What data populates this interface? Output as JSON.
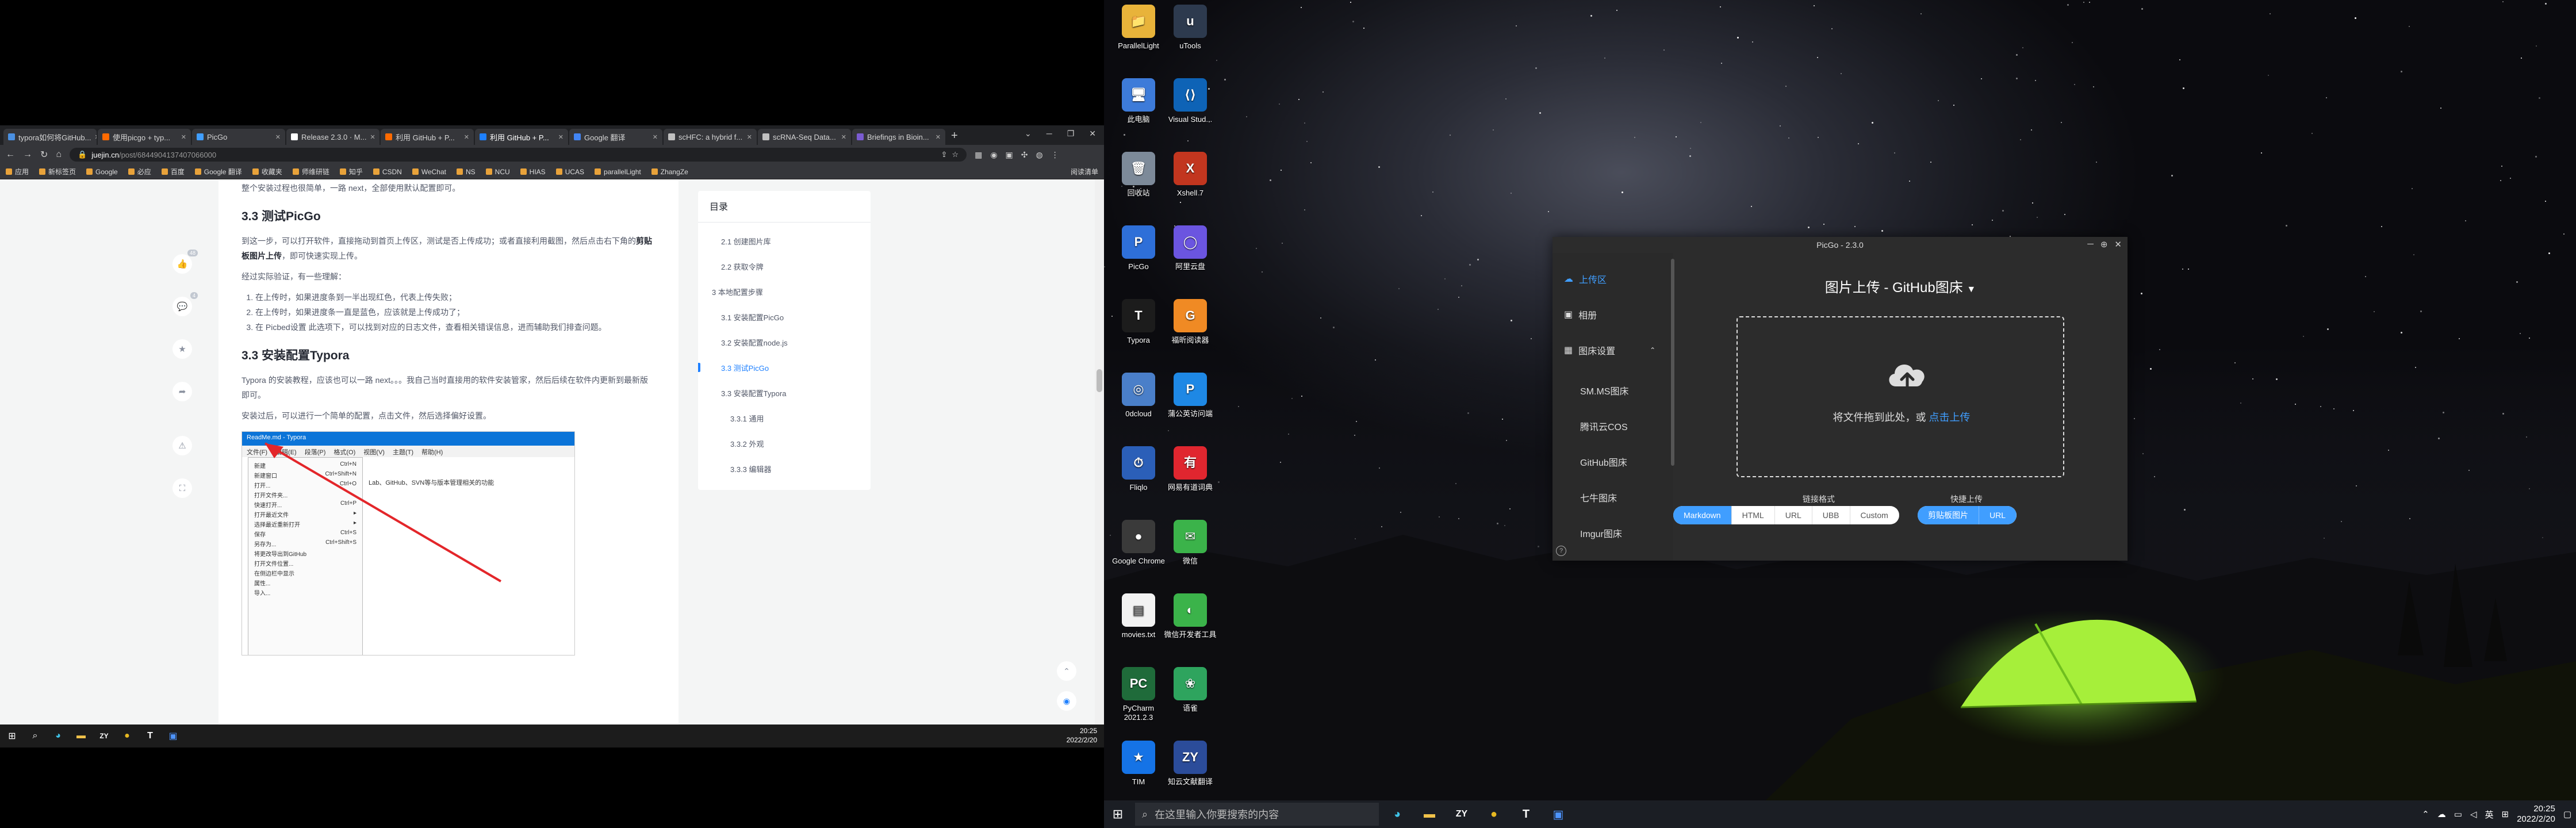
{
  "left_browser": {
    "tabs": [
      {
        "label": "typora如何将GitHub...",
        "color": "#4a90e2"
      },
      {
        "label": "使用picgo + typ...",
        "color": "#ff6a00"
      },
      {
        "label": "PicGo",
        "color": "#409eff"
      },
      {
        "label": "Release 2.3.0 · M...",
        "color": "#ffffff"
      },
      {
        "label": "利用 GitHub + P...",
        "color": "#ff6a00"
      },
      {
        "label": "利用 GitHub + P...",
        "color": "#1e80ff"
      },
      {
        "label": "Google 翻译",
        "color": "#4285f4"
      },
      {
        "label": "scHFC: a hybrid f...",
        "color": "#c0c0c0"
      },
      {
        "label": "scRNA-Seq Data...",
        "color": "#c0c0c0"
      },
      {
        "label": "Briefings in Bioin...",
        "color": "#7a5bd1"
      }
    ],
    "active_tab": 5,
    "url_host": "juejin.cn",
    "url_path": "/post/6844904137407066000",
    "bookmarks": [
      "应用",
      "新标签页",
      "Google",
      "必应",
      "百度",
      "Google 翻译",
      "收藏夹",
      "师维研链",
      "知乎",
      "CSDN",
      "WeChat",
      "NS",
      "NCU",
      "HIAS",
      "UCAS",
      "parallelLight",
      "ZhangZe"
    ],
    "reading_list": "阅读清单",
    "article": {
      "intro": "整个安装过程也很简单，一路 next，全部使用默认配置即可。",
      "h_test": "3.3 测试PicGo",
      "p_test_1": "到这一步，可以打开软件，直接拖动到首页上传区，测试是否上传成功；或者直接利用截图，然后点击右下角的",
      "p_test_1_bold": "剪贴板图片上传",
      "p_test_1_end": "，即可快速实现上传。",
      "p_test_2": "经过实际验证，有一些理解：",
      "list": [
        "在上传时，如果进度条到一半出现红色，代表上传失败；",
        "在上传时，如果进度条一直是蓝色，应该就是上传成功了；",
        "在 Picbed设置 此选项下，可以找到对应的日志文件，查看相关错误信息，进而辅助我们排查问题。"
      ],
      "h_typora": "3.3 安装配置Typora",
      "p_typora_1": "Typora 的安装教程，应该也可以一路 next。。。我自己当时直接用的软件安装管家，然后后续在软件内更新到最新版即可。",
      "p_typora_2": "安装过后，可以进行一个简单的配置，点击文件，然后选择偏好设置。",
      "shot_title": "ReadMe.md - Typora",
      "shot_menubar": [
        "文件(F)",
        "编辑(E)",
        "段落(P)",
        "格式(O)",
        "视图(V)",
        "主题(T)",
        "帮助(H)"
      ],
      "shot_menu": [
        {
          "label": "新建",
          "key": "Ctrl+N"
        },
        {
          "label": "新建窗口",
          "key": "Ctrl+Shift+N"
        },
        {
          "label": "打开...",
          "key": "Ctrl+O"
        },
        {
          "label": "打开文件夹...",
          "key": ""
        },
        {
          "label": "快速打开...",
          "key": "Ctrl+P"
        },
        {
          "label": "打开最近文件",
          "key": "▸"
        },
        {
          "label": "选择最近重新打开",
          "key": "▸"
        },
        {
          "label": "保存",
          "key": "Ctrl+S"
        },
        {
          "label": "另存为...",
          "key": "Ctrl+Shift+S"
        },
        {
          "label": "将更改导出到GitHub",
          "key": ""
        },
        {
          "label": "打开文件位置...",
          "key": ""
        },
        {
          "label": "在侧边栏中显示",
          "key": ""
        },
        {
          "label": "属性...",
          "key": ""
        },
        {
          "label": "导入...",
          "key": ""
        }
      ],
      "shot_doc_text": "Lab、GitHub、SVN等与版本管理相关的功能"
    },
    "toc": {
      "title": "目录",
      "items": [
        {
          "label": "2.1 创建图片库",
          "level": 2,
          "active": false
        },
        {
          "label": "2.2 获取令牌",
          "level": 2,
          "active": false
        },
        {
          "label": "3 本地配置步骤",
          "level": 1,
          "active": false
        },
        {
          "label": "3.1 安装配置PicGo",
          "level": 2,
          "active": false
        },
        {
          "label": "3.2 安装配置node.js",
          "level": 2,
          "active": false
        },
        {
          "label": "3.3 测试PicGo",
          "level": 2,
          "active": true
        },
        {
          "label": "3.3 安装配置Typora",
          "level": 2,
          "active": false
        },
        {
          "label": "3.3.1 通用",
          "level": 3,
          "active": false
        },
        {
          "label": "3.3.2 外观",
          "level": 3,
          "active": false
        },
        {
          "label": "3.3.3 编辑器",
          "level": 3,
          "active": false
        }
      ]
    },
    "actions": {
      "like_count": "48",
      "comment_count": "4"
    },
    "clock": {
      "time": "20:25",
      "date": "2022/2/20"
    }
  },
  "desktop_icons": [
    {
      "label": "ParallelLight",
      "glyph": "📁",
      "bg": "#e8b33a",
      "col": 0,
      "row": 0
    },
    {
      "label": "uTools",
      "glyph": "u",
      "bg": "#2d3a4e",
      "col": 1,
      "row": 0
    },
    {
      "label": "此电脑",
      "glyph": "🖥",
      "bg": "#3d7bd9",
      "col": 0,
      "row": 1
    },
    {
      "label": "Visual Stud...",
      "glyph": "⟨⟩",
      "bg": "#0e63b6",
      "col": 1,
      "row": 1
    },
    {
      "label": "回收站",
      "glyph": "🗑",
      "bg": "#7d8a99",
      "col": 0,
      "row": 2
    },
    {
      "label": "Xshell 7",
      "glyph": "X",
      "bg": "#c2361f",
      "col": 1,
      "row": 2
    },
    {
      "label": "PicGo",
      "glyph": "P",
      "bg": "#2e6fd8",
      "col": 0,
      "row": 3
    },
    {
      "label": "阿里云盘",
      "glyph": "◯",
      "bg": "#6b55e0",
      "col": 1,
      "row": 3
    },
    {
      "label": "Typora",
      "glyph": "T",
      "bg": "#1c1c1c",
      "col": 0,
      "row": 4
    },
    {
      "label": "福昕阅读器",
      "glyph": "G",
      "bg": "#f08a24",
      "col": 1,
      "row": 4
    },
    {
      "label": "0dcloud",
      "glyph": "◎",
      "bg": "#4a7fc9",
      "col": 0,
      "row": 5
    },
    {
      "label": "蒲公英访问端",
      "glyph": "P",
      "bg": "#1e88e5",
      "col": 1,
      "row": 5
    },
    {
      "label": "Fliqlo",
      "glyph": "⏱",
      "bg": "#2b5fb8",
      "col": 0,
      "row": 6
    },
    {
      "label": "网易有道词典",
      "glyph": "有",
      "bg": "#e0262f",
      "col": 1,
      "row": 6
    },
    {
      "label": "Google Chrome",
      "glyph": "●",
      "bg": "#3a3a3a",
      "col": 0,
      "row": 7
    },
    {
      "label": "微信",
      "glyph": "✉",
      "bg": "#3bb34a",
      "col": 1,
      "row": 7
    },
    {
      "label": "movies.txt",
      "glyph": "▤",
      "bg": "#f2f2f2",
      "col": 0,
      "row": 8
    },
    {
      "label": "微信开发者工具",
      "glyph": "◐",
      "bg": "#3bb34a",
      "col": 1,
      "row": 8
    },
    {
      "label": "PyCharm 2021.2.3",
      "glyph": "PC",
      "bg": "#1f6b3a",
      "col": 0,
      "row": 9
    },
    {
      "label": "语雀",
      "glyph": "❀",
      "bg": "#2ea45e",
      "col": 1,
      "row": 9
    },
    {
      "label": "TIM",
      "glyph": "★",
      "bg": "#1573e6",
      "col": 0,
      "row": 10
    },
    {
      "label": "知云文献翻译",
      "glyph": "ZY",
      "bg": "#2b4c9a",
      "col": 1,
      "row": 10
    }
  ],
  "picgo": {
    "title": "PicGo - 2.3.0",
    "nav": [
      {
        "label": "上传区",
        "icon": "cloud-icon",
        "active": true,
        "sub": false
      },
      {
        "label": "相册",
        "icon": "album-icon",
        "active": false,
        "sub": false
      },
      {
        "label": "图床设置",
        "icon": "grid-icon",
        "active": false,
        "sub": false
      },
      {
        "label": "SM.MS图床",
        "icon": "",
        "active": false,
        "sub": true
      },
      {
        "label": "腾讯云COS",
        "icon": "",
        "active": false,
        "sub": true
      },
      {
        "label": "GitHub图床",
        "icon": "",
        "active": false,
        "sub": true
      },
      {
        "label": "七牛图床",
        "icon": "",
        "active": false,
        "sub": true
      },
      {
        "label": "Imgur图床",
        "icon": "",
        "active": false,
        "sub": true
      }
    ],
    "heading": "图片上传 - GitHub图床",
    "drop_text": "将文件拖到此处，或",
    "drop_link": "点击上传",
    "format_label": "链接格式",
    "formats": [
      "Markdown",
      "HTML",
      "URL",
      "UBB",
      "Custom"
    ],
    "active_format": "Markdown",
    "quick_label": "快捷上传",
    "quick": [
      "剪贴板图片",
      "URL"
    ]
  },
  "taskbar": {
    "search_placeholder": "在这里输入你要搜索的内容",
    "apps": [
      "edge",
      "explorer",
      "zy",
      "chrome",
      "typora",
      "picgo"
    ],
    "lang": "英",
    "time": "20:25",
    "date": "2022/2/20"
  }
}
